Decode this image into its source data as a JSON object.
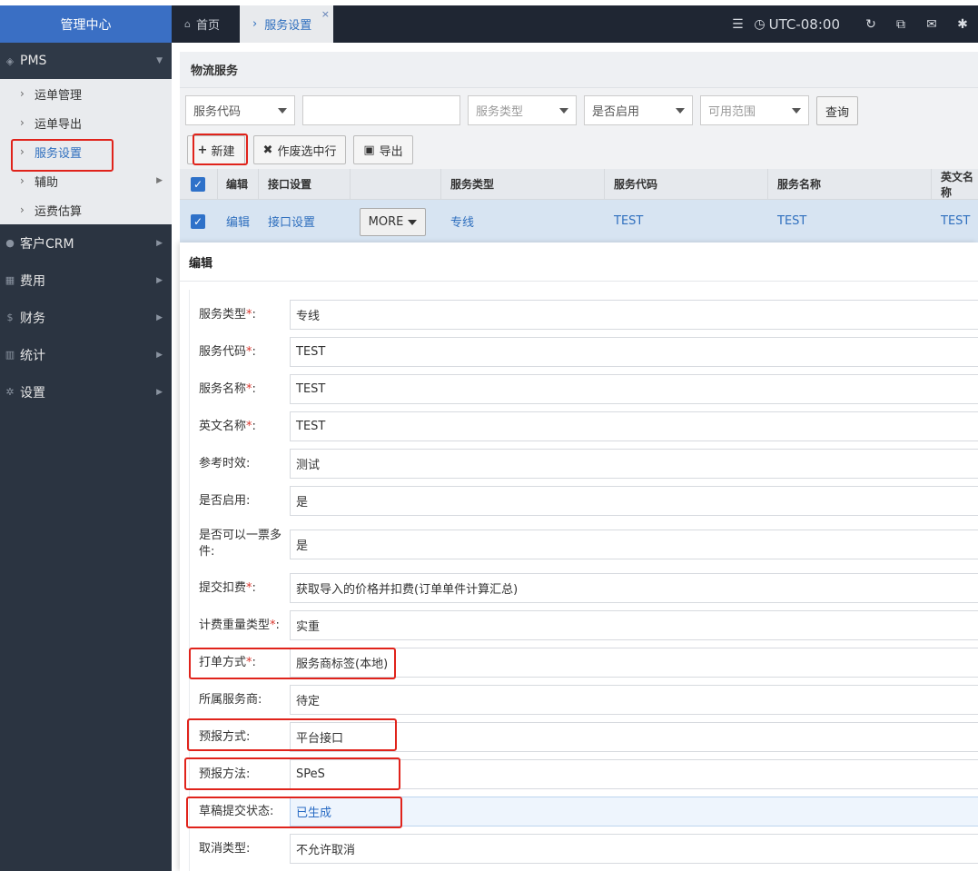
{
  "sidebar": {
    "title": "管理中心",
    "pms": "PMS",
    "sub_items": [
      "运单管理",
      "运单导出",
      "服务设置",
      "辅助",
      "运费估算"
    ],
    "sections": [
      "客户CRM",
      "费用",
      "财务",
      "统计",
      "设置"
    ]
  },
  "topbar": {
    "home_tab": "首页",
    "active_tab": "服务设置",
    "timezone": "UTC-08:00"
  },
  "panel": {
    "title": "物流服务",
    "filters": {
      "code_select": "服务代码",
      "search_value": "",
      "type_select": "服务类型",
      "enabled_select": "是否启用",
      "scope_select": "可用范围",
      "query_button": "查询"
    },
    "actions": {
      "new": "新建",
      "void_selected": "作废选中行",
      "export": "导出"
    },
    "grid": {
      "headers": [
        "编辑",
        "接口设置",
        "服务类型",
        "服务代码",
        "服务名称",
        "英文名称"
      ],
      "row": {
        "edit": "编辑",
        "interface": "接口设置",
        "more": "MORE",
        "type": "专线",
        "code": "TEST",
        "name": "TEST",
        "en_name": "TEST"
      }
    }
  },
  "dialog": {
    "title": "编辑",
    "fields": [
      {
        "label": "服务类型",
        "required": "*",
        "colon": ":",
        "value": "专线"
      },
      {
        "label": "服务代码",
        "required": "*",
        "colon": ":",
        "value": "TEST"
      },
      {
        "label": "服务名称",
        "required": "*",
        "colon": ":",
        "value": "TEST"
      },
      {
        "label": "英文名称",
        "required": "*",
        "colon": ":",
        "value": "TEST"
      },
      {
        "label": "参考时效",
        "required": "",
        "colon": ":",
        "value": "测试"
      },
      {
        "label": "是否启用",
        "required": "",
        "colon": ":",
        "value": "是"
      },
      {
        "label": "是否可以一票多件",
        "required": "",
        "colon": ":",
        "value": "是"
      },
      {
        "label": "提交扣费",
        "required": "*",
        "colon": ":",
        "value": "获取导入的价格并扣费(订单单件计算汇总)"
      },
      {
        "label": "计费重量类型",
        "required": "*",
        "colon": ":",
        "value": "实重"
      },
      {
        "label": "打单方式",
        "required": "*",
        "colon": ":",
        "value": "服务商标签(本地)"
      },
      {
        "label": "所属服务商",
        "required": "",
        "colon": ":",
        "value": "待定"
      },
      {
        "label": "预报方式",
        "required": "",
        "colon": ":",
        "value": "平台接口"
      },
      {
        "label": "预报方法",
        "required": "",
        "colon": ":",
        "value": "SPeS"
      },
      {
        "label": "草稿提交状态",
        "required": "",
        "colon": ":",
        "value": "已生成"
      },
      {
        "label": "取消类型",
        "required": "",
        "colon": ":",
        "value": "不允许取消"
      }
    ]
  },
  "colors": {
    "sidebar_bg": "#2b3441",
    "sidebar_header": "#3a6fc4",
    "accent_blue": "#2f6fbe",
    "highlight_red": "#e0231b",
    "required_red": "#d9342b"
  }
}
